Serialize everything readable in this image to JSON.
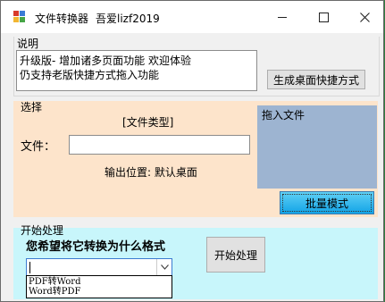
{
  "window": {
    "title": "文件转换器",
    "title_suffix": "吾爱lizf2019",
    "min_symbol": "—",
    "max_symbol": "☐",
    "close_symbol": "✕"
  },
  "description": {
    "group_label": "说明",
    "lines": [
      "升级版- 增加诸多页面功能 欢迎体验",
      "仍支持老版快捷方式拖入功能"
    ],
    "shortcut_button": "生成桌面快捷方式"
  },
  "select": {
    "group_label": "选择",
    "file_type_label": "[文件类型]",
    "file_label": "文件：",
    "file_value": "",
    "output_label": "输出位置: 默认桌面",
    "drop_label": "拖入文件",
    "batch_button": "批量模式",
    "batch_color": "#12a3e6",
    "drop_color": "#9db4d1",
    "panel_color": "#fde4cb"
  },
  "process": {
    "group_label": "开始处理",
    "question": "您希望将它转换为什么格式",
    "start_button": "开始处理",
    "combo_value": "",
    "options": [
      "PDF转Word",
      "Word转PDF"
    ],
    "panel_color": "#c8f6fb"
  },
  "icons": {
    "app": "app-icon",
    "dropdown": "chevron-down-icon"
  }
}
